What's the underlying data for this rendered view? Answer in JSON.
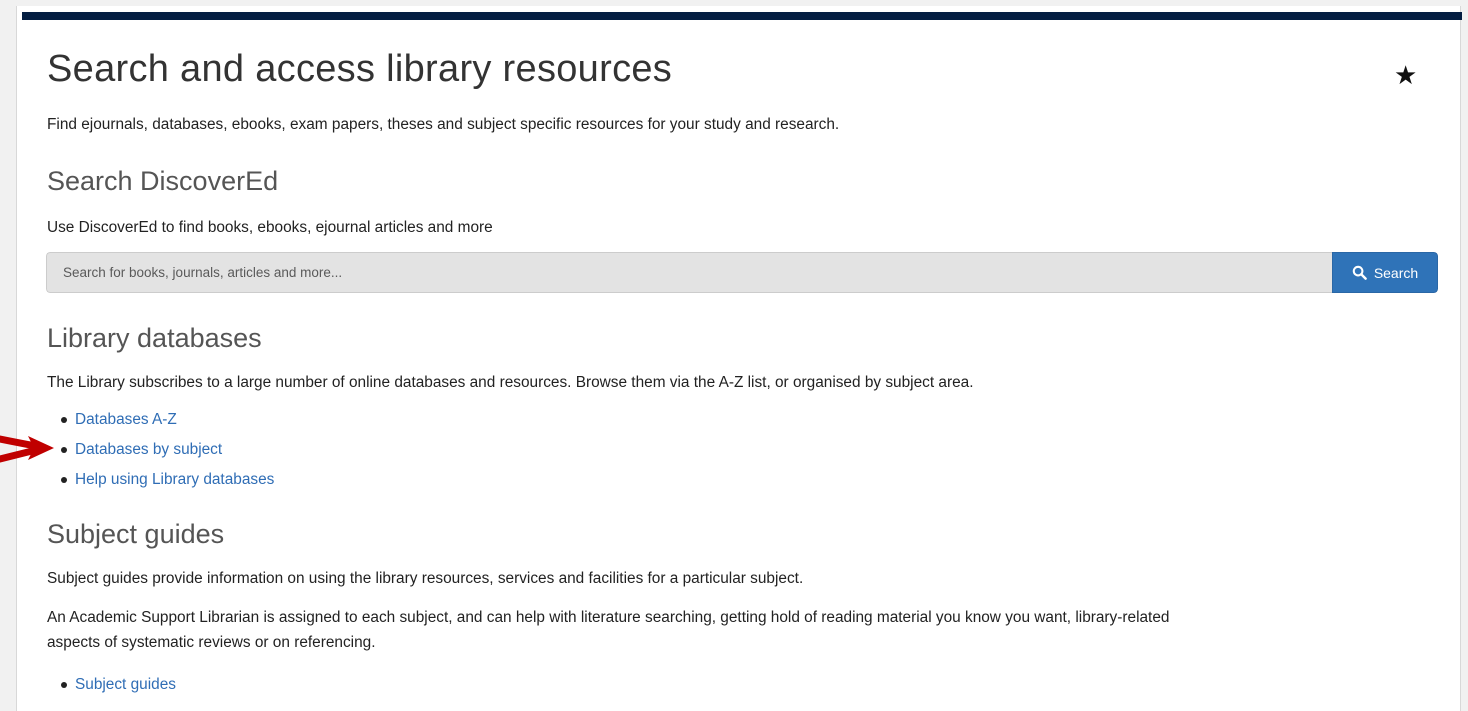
{
  "header": {
    "title": "Search and access library resources",
    "intro": "Find ejournals, databases, ebooks, exam papers, theses and subject specific resources for your study and research.",
    "star_glyph": "★"
  },
  "discovered": {
    "heading": "Search DiscoverEd",
    "description": "Use DiscoverEd to find books, ebooks, ejournal articles and more",
    "search_placeholder": "Search for books, journals, articles and more...",
    "search_button_label": "Search",
    "search_icon": "magnifier-icon"
  },
  "databases": {
    "heading": "Library databases",
    "description": "The Library subscribes to a large number of online databases and resources. Browse them via the A-Z list, or organised by subject area.",
    "links": [
      {
        "label": "Databases A-Z"
      },
      {
        "label": "Databases by subject"
      },
      {
        "label": "Help using Library databases"
      }
    ]
  },
  "subject_guides": {
    "heading": "Subject guides",
    "description": "Subject guides provide information on using the library resources, services and facilities for a particular subject.",
    "description2_line1": "An Academic Support Librarian is assigned to each subject, and can help with literature searching, getting hold of reading material you know you want, library-related",
    "description2_line2": "aspects of systematic reviews or on referencing.",
    "links": [
      {
        "label": "Subject guides"
      }
    ]
  },
  "colors": {
    "topbar": "#041e42",
    "link": "#2f6db5",
    "button": "#2f73b8",
    "arrow": "#c00000"
  },
  "annotation": {
    "arrow_icon": "red-arrow-icon"
  }
}
